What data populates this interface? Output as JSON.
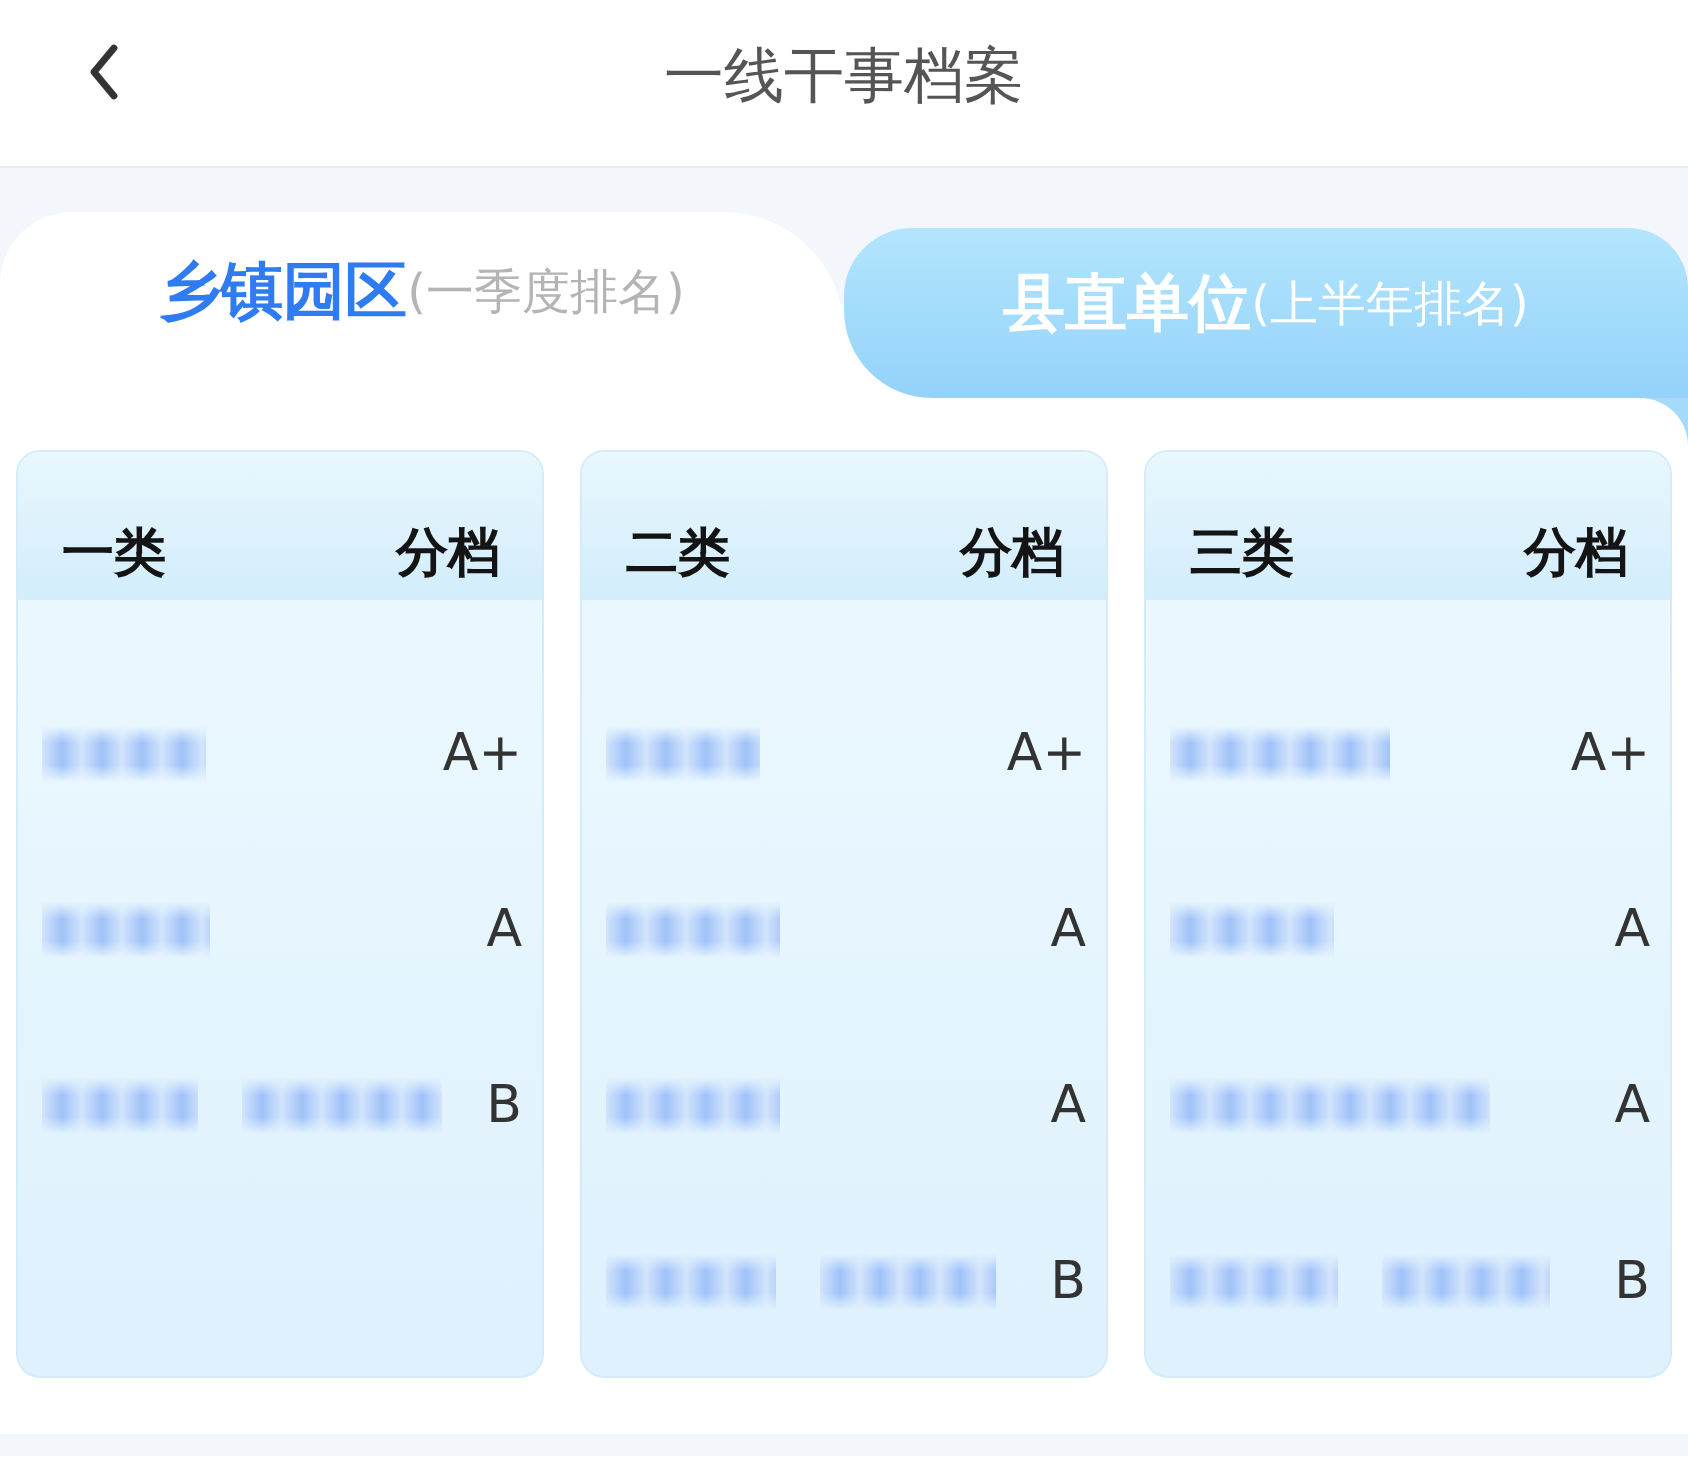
{
  "title": "一线干事档案",
  "tabs": [
    {
      "label": "乡镇园区",
      "note": "(一季度排名)",
      "selected": true
    },
    {
      "label": "县直单位",
      "note": "(上半年排名)",
      "selected": false
    }
  ],
  "categories": [
    {
      "title": "一类",
      "grade_heading": "分档",
      "rows": [
        {
          "names": [
            {
              "kind": "blurred"
            }
          ],
          "grade": "A+"
        },
        {
          "names": [
            {
              "kind": "blurred"
            }
          ],
          "grade": "A"
        },
        {
          "names": [
            {
              "kind": "blurred"
            },
            {
              "kind": "blurred"
            }
          ],
          "grade": "B"
        }
      ]
    },
    {
      "title": "二类",
      "grade_heading": "分档",
      "rows": [
        {
          "names": [
            {
              "kind": "blurred"
            }
          ],
          "grade": "A+"
        },
        {
          "names": [
            {
              "kind": "blurred"
            }
          ],
          "grade": "A"
        },
        {
          "names": [
            {
              "kind": "blurred"
            }
          ],
          "grade": "A"
        },
        {
          "names": [
            {
              "kind": "blurred"
            },
            {
              "kind": "blurred"
            }
          ],
          "grade": "B"
        }
      ]
    },
    {
      "title": "三类",
      "grade_heading": "分档",
      "rows": [
        {
          "names": [
            {
              "kind": "blurred"
            }
          ],
          "grade": "A+"
        },
        {
          "names": [
            {
              "kind": "blurred"
            }
          ],
          "grade": "A"
        },
        {
          "names": [
            {
              "kind": "blurred"
            }
          ],
          "grade": "A"
        },
        {
          "names": [
            {
              "kind": "blurred"
            },
            {
              "kind": "blurred"
            }
          ],
          "grade": "B"
        }
      ]
    }
  ]
}
